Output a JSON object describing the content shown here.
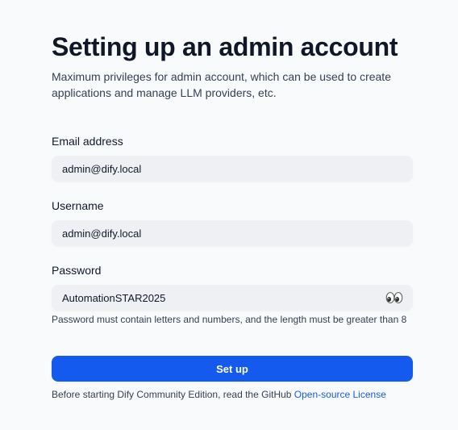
{
  "header": {
    "title": "Setting up an admin account",
    "subtitle": "Maximum privileges for admin account, which can be used to create applications and manage LLM providers, etc."
  },
  "form": {
    "email": {
      "label": "Email address",
      "value": "admin@dify.local"
    },
    "username": {
      "label": "Username",
      "value": "admin@dify.local"
    },
    "password": {
      "label": "Password",
      "value": "AutomationSTAR2025",
      "toggle_icon": "eyes-icon",
      "hint": "Password must contain letters and numbers, and the length must be greater than 8"
    },
    "submit_label": "Set up"
  },
  "footer": {
    "text": "Before starting Dify Community Edition, read the GitHub ",
    "link_text": "Open-source License"
  },
  "colors": {
    "primary": "#155aef",
    "background": "#f9fafb",
    "input_bg": "#eff0f3",
    "text": "#101828",
    "secondary_text": "#354052"
  }
}
